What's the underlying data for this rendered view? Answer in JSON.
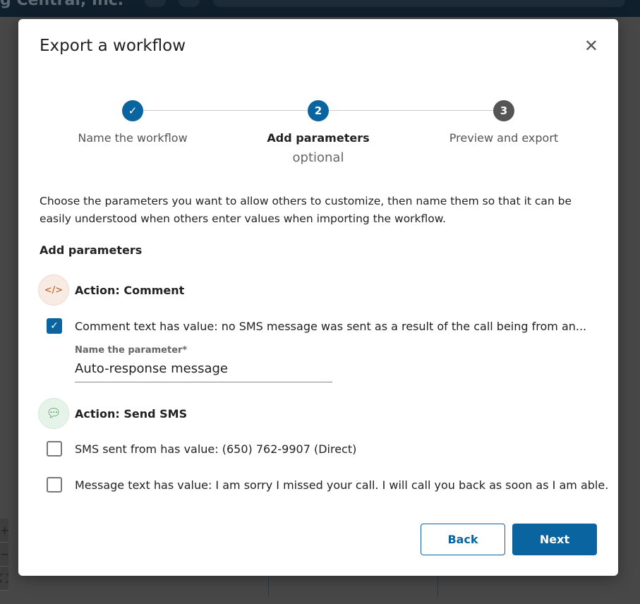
{
  "background": {
    "brand_text": "g Central, Inc."
  },
  "modal": {
    "title": "Export a workflow",
    "close_icon": "close-icon",
    "steps": [
      {
        "number": "✓",
        "label": "Name the workflow",
        "state": "complete"
      },
      {
        "number": "2",
        "label": "Add parameters",
        "sublabel": "optional",
        "state": "active"
      },
      {
        "number": "3",
        "label": "Preview and export",
        "state": "upcoming"
      }
    ],
    "description": "Choose the parameters you want to allow others to customize, then name them so that it can be easily understood when others enter values when importing the workflow.",
    "section_heading": "Add parameters",
    "actions": [
      {
        "icon": "code-icon",
        "label": "Action: Comment"
      },
      {
        "icon": "chat-bubble-icon",
        "label": "Action: Send SMS"
      }
    ],
    "params": [
      {
        "label": "Comment text has value: no SMS message was sent as a result of the call being from an...",
        "checked": true
      },
      {
        "label": "SMS sent from has value: (650) 762-9907 (Direct)",
        "checked": false
      },
      {
        "label": "Message text has value: I am sorry I missed your call. I will call you back as soon as I am able.",
        "checked": false
      }
    ],
    "param_name_field": {
      "label": "Name the parameter",
      "required_mark": "*",
      "value": "Auto-response message"
    },
    "back_label": "Back",
    "next_label": "Next"
  },
  "colors": {
    "primary": "#0a64a0",
    "complete": "#0a64a0",
    "upcoming": "#555555"
  }
}
